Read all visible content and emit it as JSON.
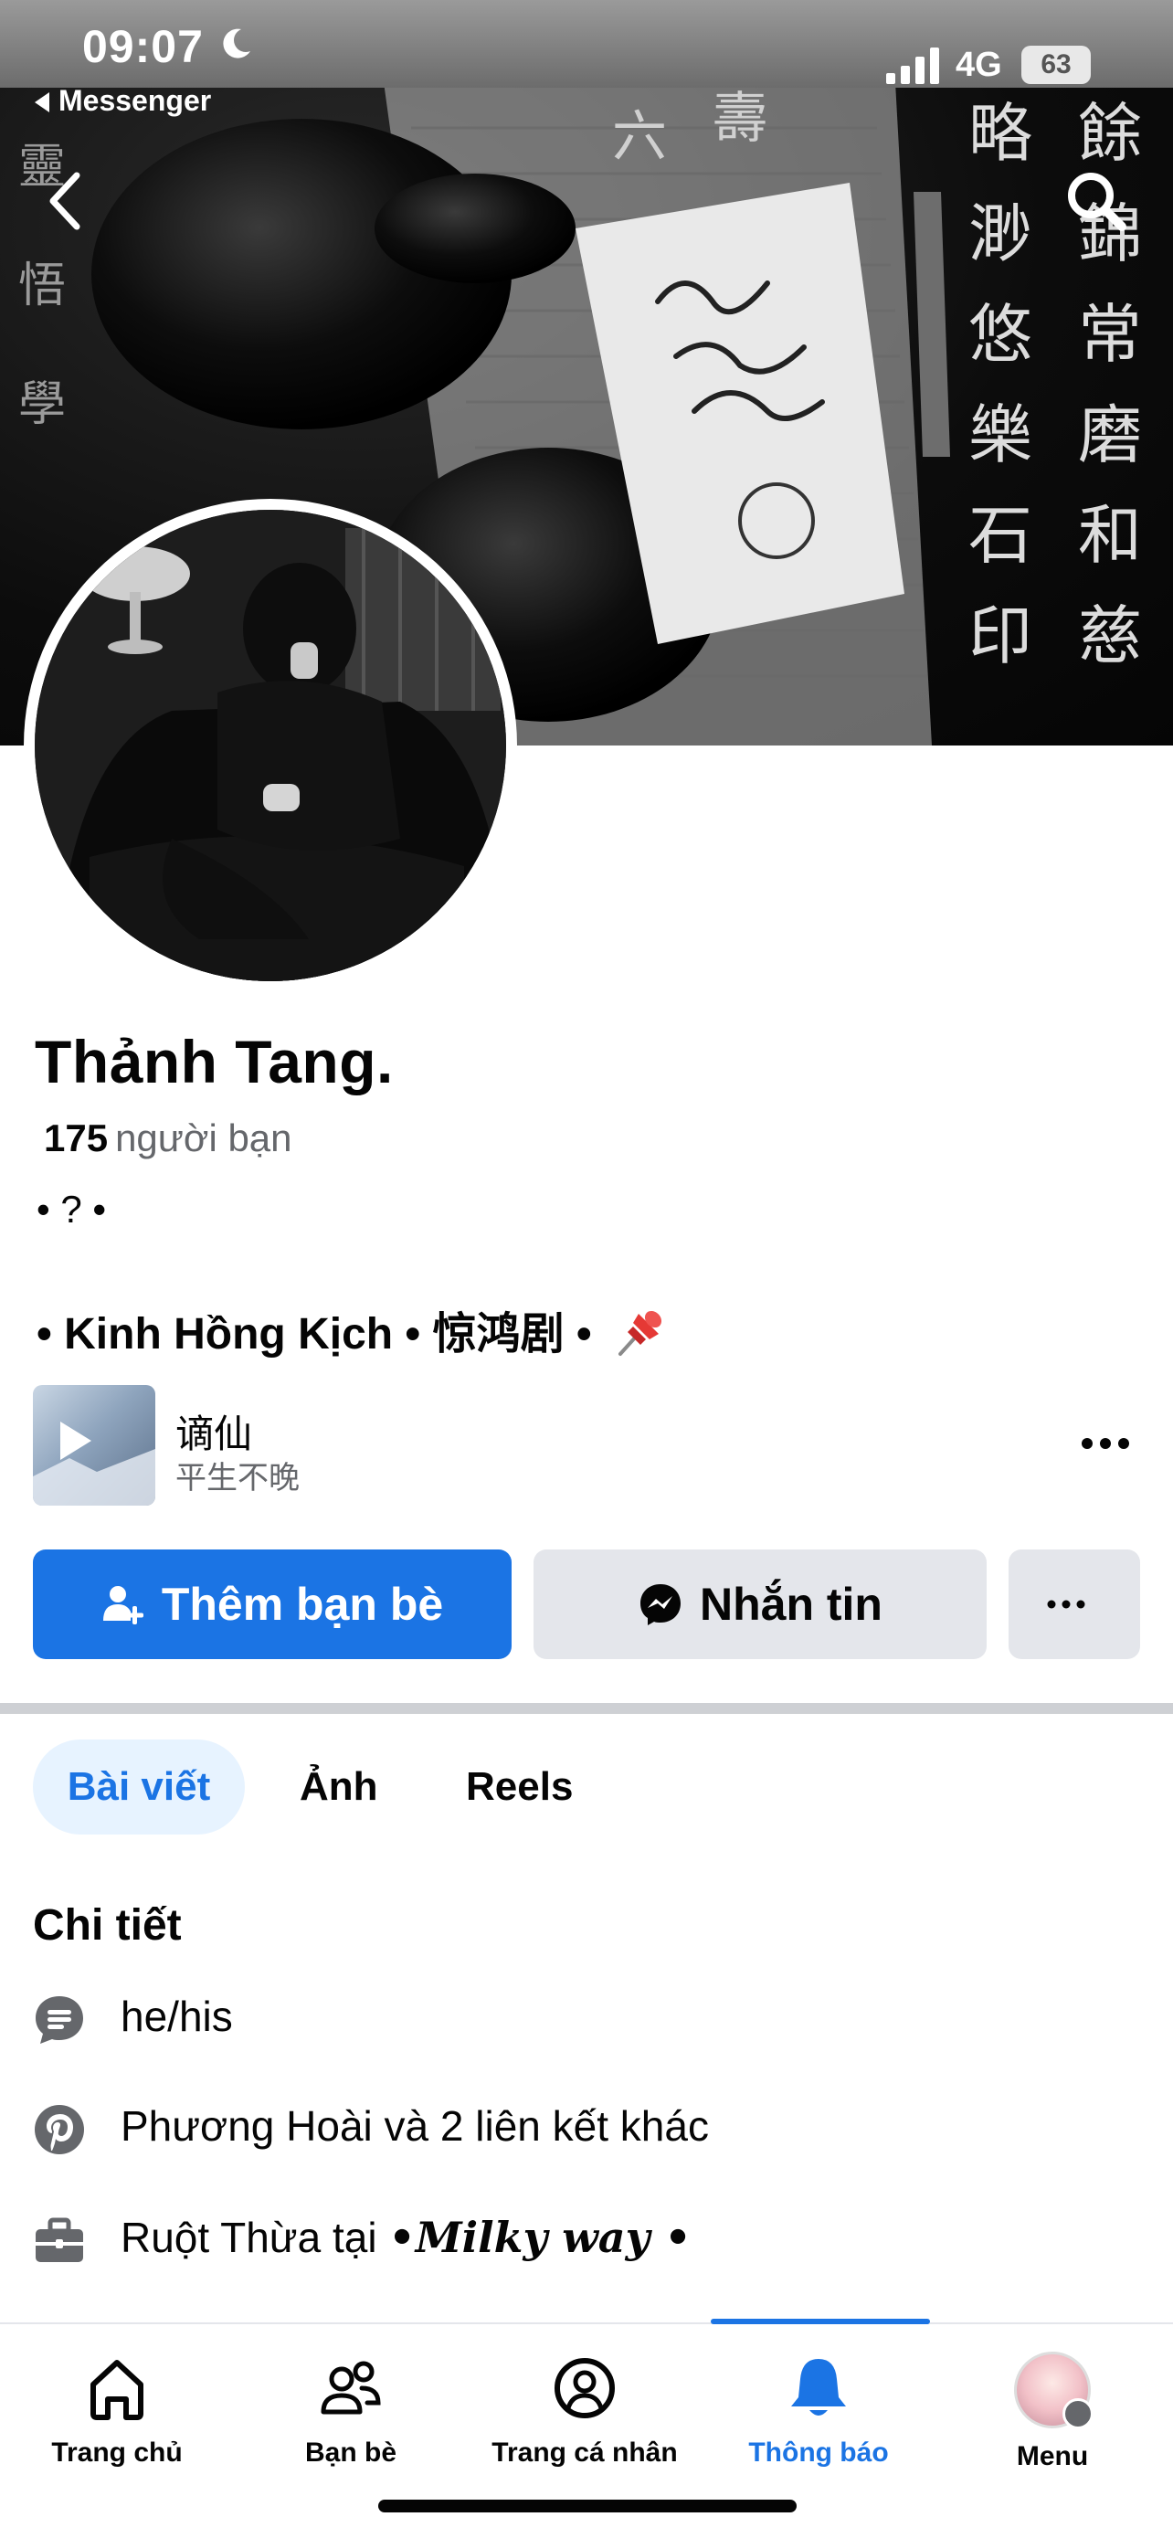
{
  "status_bar": {
    "time": "09:07",
    "network": "4G",
    "battery": "63",
    "back_app": "Messenger"
  },
  "profile": {
    "name": "Thảnh Tang.",
    "friends_count": "175",
    "friends_label": "người bạn",
    "bio_line1": "• ? •",
    "bio_line2": "• Kinh Hồng Kịch • 惊鸿剧 •"
  },
  "music": {
    "title": "谪仙",
    "artist": "平生不晚"
  },
  "actions": {
    "add_friend": "Thêm bạn bè",
    "message": "Nhắn tin"
  },
  "tabs": [
    {
      "label": "Bài viết",
      "active": true
    },
    {
      "label": "Ảnh",
      "active": false
    },
    {
      "label": "Reels",
      "active": false
    }
  ],
  "details": {
    "title": "Chi tiết",
    "items": [
      {
        "icon": "chat-bubble-icon",
        "text": "he/his"
      },
      {
        "icon": "pinterest-icon",
        "text": "Phương Hoài và 2 liên kết khác"
      },
      {
        "icon": "briefcase-icon",
        "prefix": "Ruột Thừa tại ",
        "fancy": "•𝑴𝒊𝒍𝒌𝒚 𝒘𝒂𝒚 •"
      }
    ]
  },
  "bottom_nav": [
    {
      "label": "Trang chủ",
      "icon": "home-icon"
    },
    {
      "label": "Bạn bè",
      "icon": "friends-icon"
    },
    {
      "label": "Trang cá nhân",
      "icon": "profile-icon"
    },
    {
      "label": "Thông báo",
      "icon": "bell-icon",
      "active": true
    },
    {
      "label": "Menu",
      "icon": "menu-avatar-icon"
    }
  ],
  "colors": {
    "accent": "#1b74e4",
    "secondary_button": "#e4e6eb",
    "muted_text": "#65676b",
    "active_tab_bg": "#e7f3ff"
  }
}
